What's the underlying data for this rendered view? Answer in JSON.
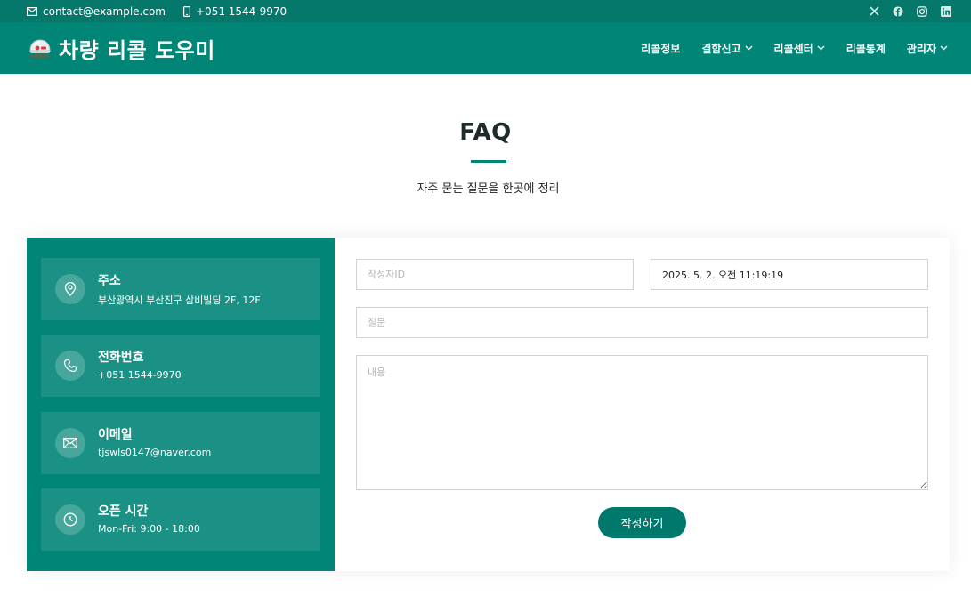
{
  "topbar": {
    "email": "contact@example.com",
    "phone": "+051 1544-9970",
    "social_icons": [
      "x-icon",
      "facebook-icon",
      "instagram-icon",
      "linkedin-icon"
    ]
  },
  "header": {
    "logo_title": "차량 리콜 도우미",
    "nav": [
      {
        "label": "리콜정보",
        "has_dropdown": false
      },
      {
        "label": "결함신고",
        "has_dropdown": true
      },
      {
        "label": "리콜센터",
        "has_dropdown": true
      },
      {
        "label": "리콜통계",
        "has_dropdown": false
      },
      {
        "label": "관리자",
        "has_dropdown": true
      }
    ]
  },
  "section": {
    "title": "FAQ",
    "subtitle": "자주 묻는 질문을 한곳에 정리"
  },
  "info": [
    {
      "title": "주소",
      "text": "부산광역시 부산진구 삼비빌딩 2F, 12F",
      "icon": "map-pin-icon"
    },
    {
      "title": "전화번호",
      "text": "+051 1544-9970",
      "icon": "phone-icon"
    },
    {
      "title": "이메일",
      "text": "tjswls0147@naver.com",
      "icon": "envelope-icon"
    },
    {
      "title": "오픈 시간",
      "text": "Mon-Fri: 9:00 - 18:00",
      "icon": "clock-icon"
    }
  ],
  "form": {
    "author_placeholder": "작성자ID",
    "date_value": "2025. 5. 2. 오전 11:19:19",
    "question_placeholder": "질문",
    "content_placeholder": "내용",
    "submit_label": "작성하기"
  },
  "colors": {
    "brand": "#008576",
    "topbar": "#06776b"
  }
}
